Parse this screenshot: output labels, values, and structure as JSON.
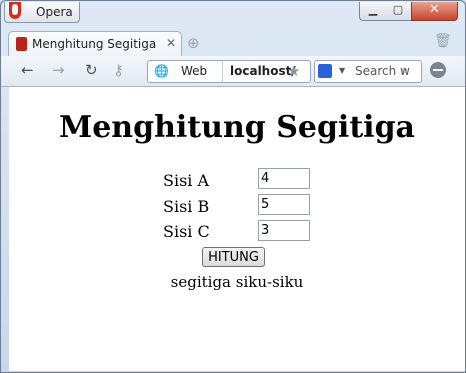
{
  "browser": {
    "menu_label": "Opera",
    "tab": {
      "title": "Menghitung Segitiga"
    },
    "address": {
      "scheme_label": "Web",
      "url": "localhost/"
    },
    "search": {
      "placeholder": "Search w"
    }
  },
  "page": {
    "title": "Menghitung Segitiga",
    "fields": [
      {
        "label": "Sisi A",
        "value": "4"
      },
      {
        "label": "Sisi B",
        "value": "5"
      },
      {
        "label": "Sisi C",
        "value": "3"
      }
    ],
    "button_label": "HITUNG",
    "result": "segitiga siku-siku"
  },
  "icons": {
    "opera_logo": "opera-logo-icon",
    "back": "arrow-left-icon",
    "forward": "arrow-right-icon",
    "reload": "reload-icon",
    "key": "key-icon",
    "globe": "globe-icon",
    "star": "star-icon",
    "search_engine": "google-icon",
    "magnify": "search-icon",
    "block": "no-entry-icon"
  },
  "colors": {
    "frame": "#c9d7ea",
    "close_button": "#c8432c",
    "opera_red": "#d52b1e"
  }
}
